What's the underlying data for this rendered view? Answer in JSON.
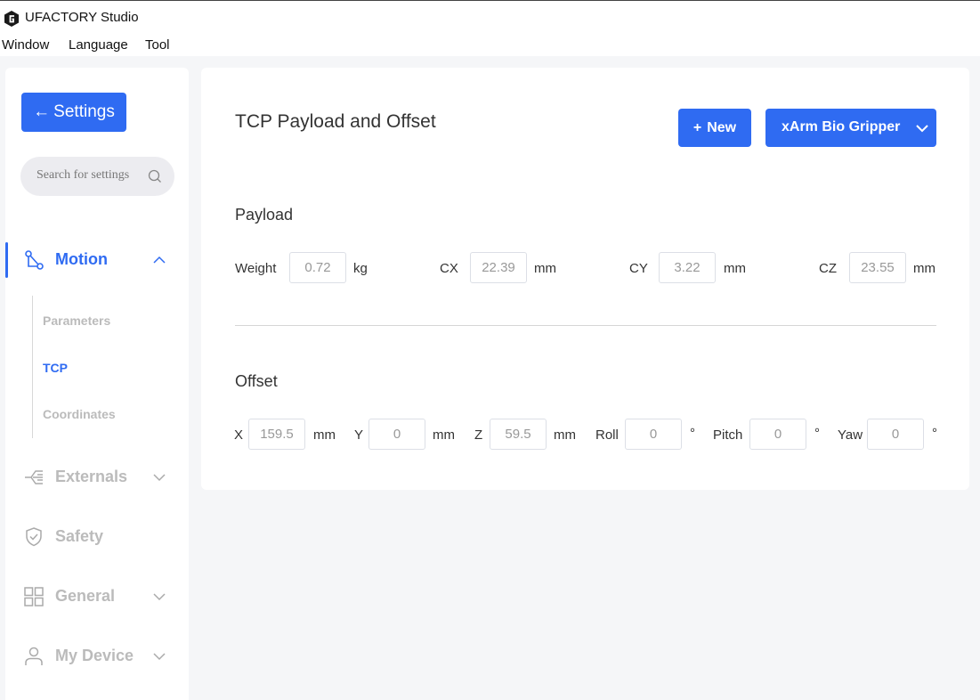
{
  "app": {
    "title": "UFACTORY Studio"
  },
  "menu": [
    "Window",
    "Language",
    "Tool"
  ],
  "sidebar": {
    "back_label": "Settings",
    "search_placeholder": "Search for settings",
    "nav": [
      {
        "label": "Motion",
        "icon": "motion-icon",
        "active": true,
        "expanded": true
      },
      {
        "label": "Externals",
        "icon": "externals-icon",
        "active": false,
        "expanded": false
      },
      {
        "label": "Safety",
        "icon": "shield-icon",
        "active": false
      },
      {
        "label": "General",
        "icon": "grid-icon",
        "active": false,
        "expanded": false
      },
      {
        "label": "My Device",
        "icon": "user-icon",
        "active": false,
        "expanded": false
      }
    ],
    "subnav": [
      {
        "label": "Parameters",
        "active": false
      },
      {
        "label": "TCP",
        "active": true
      },
      {
        "label": "Coordinates",
        "active": false
      }
    ]
  },
  "main": {
    "title": "TCP Payload and Offset",
    "new_label": "New",
    "profile_selected": "xArm Bio Gripper",
    "payload": {
      "title": "Payload",
      "fields": [
        {
          "label": "Weight",
          "value": "0.72",
          "unit": "kg"
        },
        {
          "label": "CX",
          "value": "22.39",
          "unit": "mm"
        },
        {
          "label": "CY",
          "value": "3.22",
          "unit": "mm"
        },
        {
          "label": "CZ",
          "value": "23.55",
          "unit": "mm"
        }
      ]
    },
    "offset": {
      "title": "Offset",
      "fields": [
        {
          "label": "X",
          "value": "159.5",
          "unit": "mm"
        },
        {
          "label": "Y",
          "value": "0",
          "unit": "mm"
        },
        {
          "label": "Z",
          "value": "59.5",
          "unit": "mm"
        },
        {
          "label": "Roll",
          "value": "0",
          "unit": "°"
        },
        {
          "label": "Pitch",
          "value": "0",
          "unit": "°"
        },
        {
          "label": "Yaw",
          "value": "0",
          "unit": "°"
        }
      ]
    }
  },
  "colors": {
    "accent": "#2f6bf2",
    "muted": "#bbbbbb",
    "background": "#f5f6f8"
  }
}
